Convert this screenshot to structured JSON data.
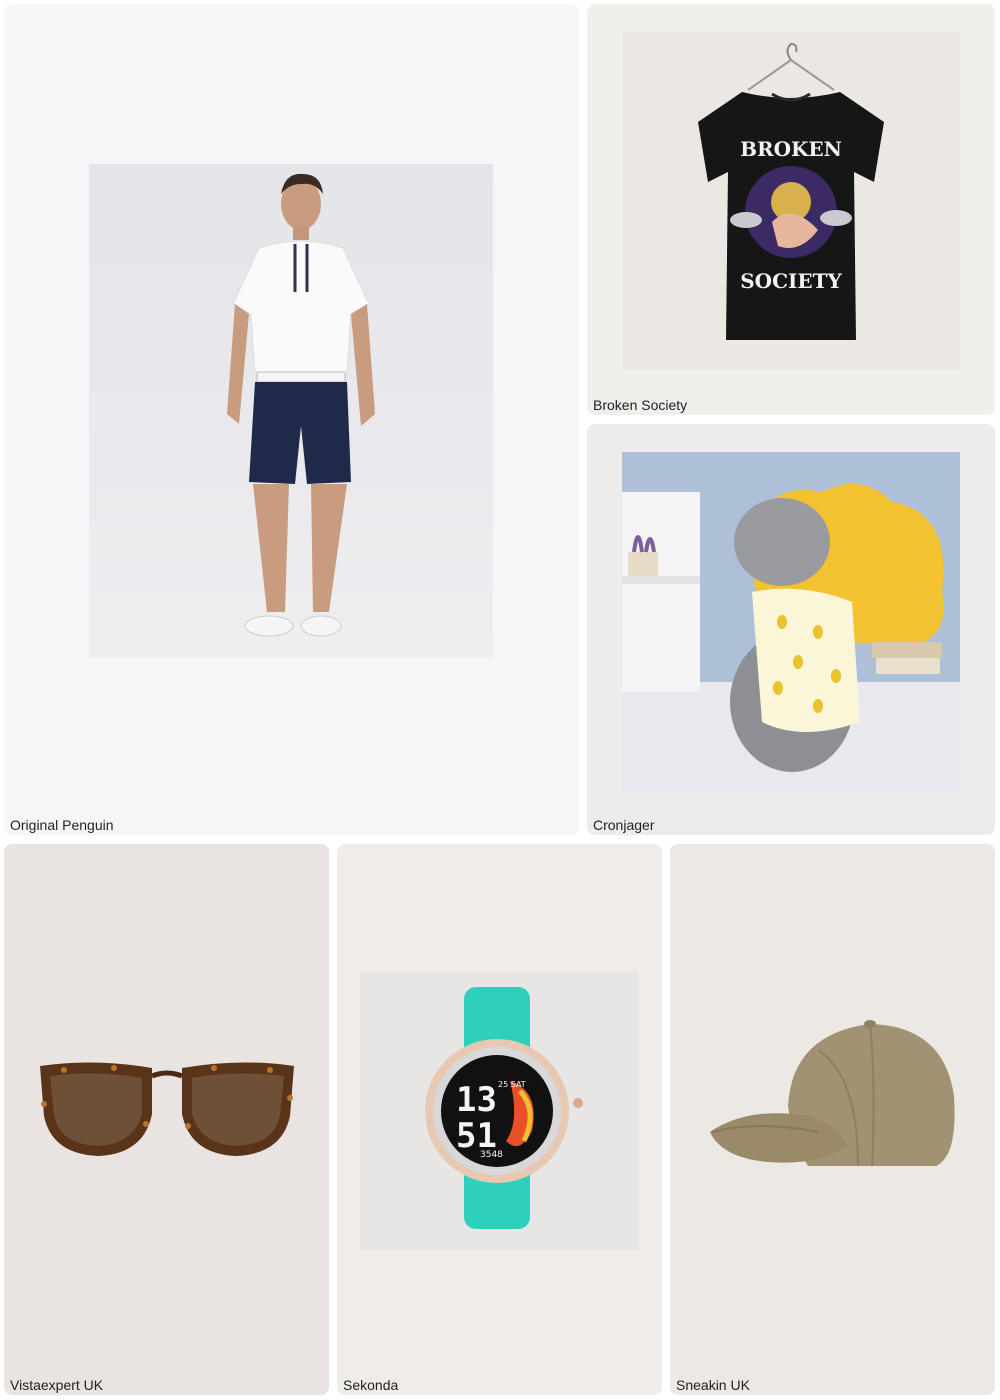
{
  "grid": {
    "items": [
      {
        "brand": "Original Penguin",
        "icon": "polo-shirt-model-image",
        "bg": "#f6f6f8"
      },
      {
        "brand": "Broken Society",
        "icon": "black-graphic-tshirt-image",
        "bg": "#f1efec",
        "print_top": "BROKEN",
        "print_bottom": "SOCIETY"
      },
      {
        "brand": "Cronjager",
        "icon": "dog-lemon-shirt-image",
        "bg": "#edebec"
      },
      {
        "brand": "Vistaexpert UK",
        "icon": "sunglasses-image",
        "bg": "#e9e4e1"
      },
      {
        "brand": "Sekonda",
        "icon": "smartwatch-image",
        "bg": "#efece9",
        "watch_hour": "13",
        "watch_minute": "51",
        "watch_date": "25 SAT",
        "watch_steps": "3548"
      },
      {
        "brand": "Sneakin UK",
        "icon": "baseball-cap-image",
        "bg": "#ece8e4"
      }
    ]
  }
}
